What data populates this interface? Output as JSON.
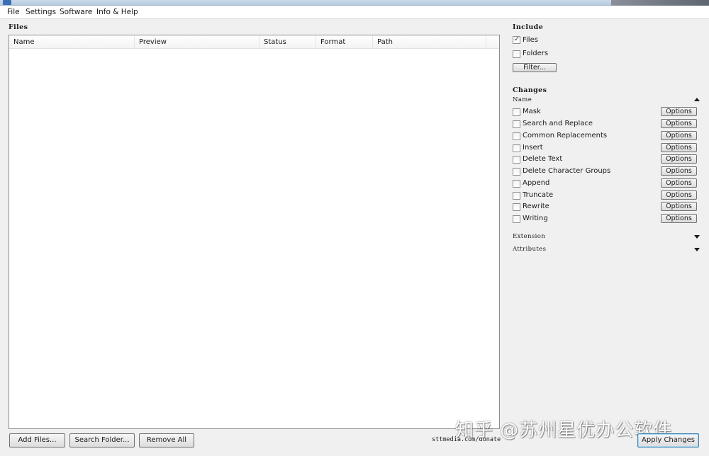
{
  "menu": [
    "File",
    "Settings",
    "Software",
    "Info & Help"
  ],
  "files": {
    "title": "Files",
    "columns": [
      "Name",
      "Preview",
      "Status",
      "Format",
      "Path"
    ]
  },
  "bottom": {
    "add_files": "Add Files...",
    "search_folder": "Search Folder...",
    "remove_all": "Remove All",
    "donate": "sttmedia.com/donate",
    "apply": "Apply Changes"
  },
  "include": {
    "title": "Include",
    "files_label": "Files",
    "files_checked": true,
    "folders_label": "Folders",
    "folders_checked": false,
    "filter_button": "Filter..."
  },
  "changes": {
    "title": "Changes",
    "name_header": "Name",
    "options_label": "Options",
    "items": [
      "Mask",
      "Search and Replace",
      "Common Replacements",
      "Insert",
      "Delete Text",
      "Delete Character Groups",
      "Append",
      "Truncate",
      "Rewrite",
      "Writing"
    ],
    "extension_header": "Extension",
    "attributes_header": "Attributes"
  },
  "watermark": "知乎 @苏州星优办公软件"
}
